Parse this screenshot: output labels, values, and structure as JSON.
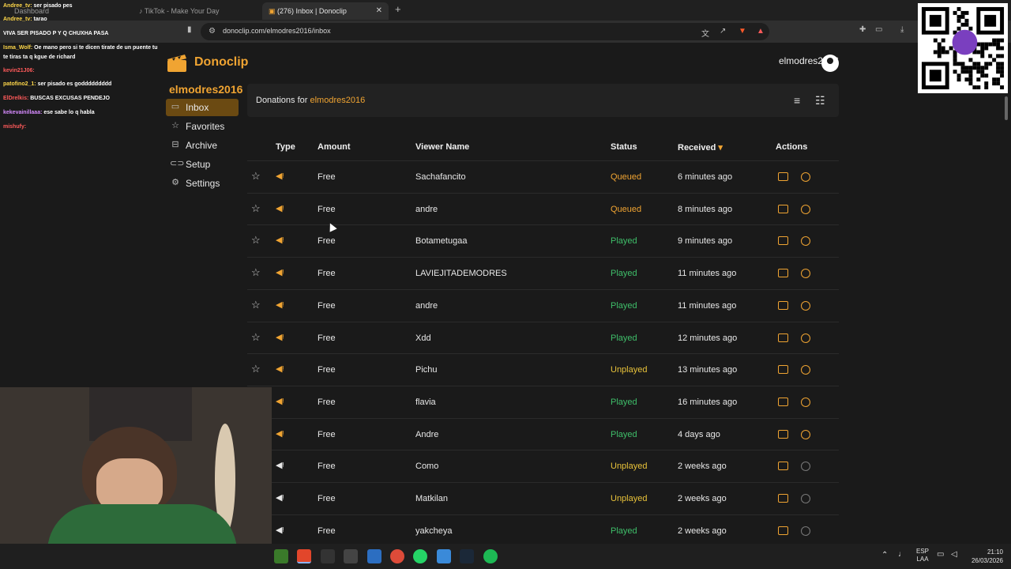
{
  "browser": {
    "tabs": [
      {
        "label": "Dashboard"
      },
      {
        "label": "TikTok - Make Your Day"
      },
      {
        "label": "(276) Inbox | Donoclip"
      }
    ],
    "url": "donoclip.com/elmodres2016/inbox"
  },
  "app": {
    "name": "Donoclip",
    "user": "elmodres2016",
    "channel": "elmodres2016",
    "header_prefix": "Donations for ",
    "header_channel": "elmodres2016",
    "accent": "#f0a432"
  },
  "sidebar": {
    "items": [
      {
        "label": "Inbox",
        "icon": "inbox-icon"
      },
      {
        "label": "Favorites",
        "icon": "star-icon"
      },
      {
        "label": "Archive",
        "icon": "archive-icon"
      },
      {
        "label": "Setup",
        "icon": "link-icon"
      },
      {
        "label": "Settings",
        "icon": "gear-icon"
      }
    ]
  },
  "table": {
    "columns": [
      "Type",
      "Amount",
      "Viewer Name",
      "Status",
      "Received",
      "Actions"
    ],
    "sort_indicator": "▾",
    "rows": [
      {
        "amount": "Free",
        "viewer": "Sachafancito",
        "status": "Queued",
        "received": "6 minutes ago"
      },
      {
        "amount": "Free",
        "viewer": "andre",
        "status": "Queued",
        "received": "8 minutes ago"
      },
      {
        "amount": "Free",
        "viewer": "Botametugaa",
        "status": "Played",
        "received": "9 minutes ago"
      },
      {
        "amount": "Free",
        "viewer": "LAVIEJITADEMODRES",
        "status": "Played",
        "received": "11 minutes ago"
      },
      {
        "amount": "Free",
        "viewer": "andre",
        "status": "Played",
        "received": "11 minutes ago"
      },
      {
        "amount": "Free",
        "viewer": "Xdd",
        "status": "Played",
        "received": "12 minutes ago"
      },
      {
        "amount": "Free",
        "viewer": "Pichu",
        "status": "Unplayed",
        "received": "13 minutes ago"
      },
      {
        "amount": "Free",
        "viewer": "flavia",
        "status": "Played",
        "received": "16 minutes ago"
      },
      {
        "amount": "Free",
        "viewer": "Andre",
        "status": "Played",
        "received": "4 days ago"
      },
      {
        "amount": "Free",
        "viewer": "Como",
        "status": "Unplayed",
        "received": "2 weeks ago"
      },
      {
        "amount": "Free",
        "viewer": "Matkilan",
        "status": "Unplayed",
        "received": "2 weeks ago"
      },
      {
        "amount": "Free",
        "viewer": "yakcheya",
        "status": "Played",
        "received": "2 weeks ago"
      }
    ],
    "status_colors": {
      "Queued": "#f0a432",
      "Played": "#3fbf6a",
      "Unplayed": "#e8c23a"
    }
  },
  "chat": {
    "messages": [
      {
        "user": "Andree_tv:",
        "text": "ser pisado pes"
      },
      {
        "user": "Andree_tv:",
        "text": "tarao"
      },
      {
        "user": "",
        "text": "VIVA SER PISADO P Y Q CHUXHA PASA"
      },
      {
        "user": "Isma_Wolf:",
        "text": "Oe mano pero si te dicen tirate de un puente tu"
      },
      {
        "user": "",
        "text": "te tiras ta q kgue de richard"
      },
      {
        "user": "kevin21J06:",
        "text": ""
      },
      {
        "user": "patofino2_1:",
        "text": "ser pisado es goddddddddd"
      },
      {
        "user": "ElDrelkis:",
        "text": "BUSCAS EXCUSAS PENDEJO"
      },
      {
        "user": "kekevainillaaa:",
        "text": "ese sabe lo q habla"
      },
      {
        "user": "mishufy:",
        "text": ""
      }
    ]
  },
  "taskbar": {
    "lang": "ESP",
    "lang2": "LAA",
    "time": "21:10",
    "date": "26/03/2026"
  }
}
